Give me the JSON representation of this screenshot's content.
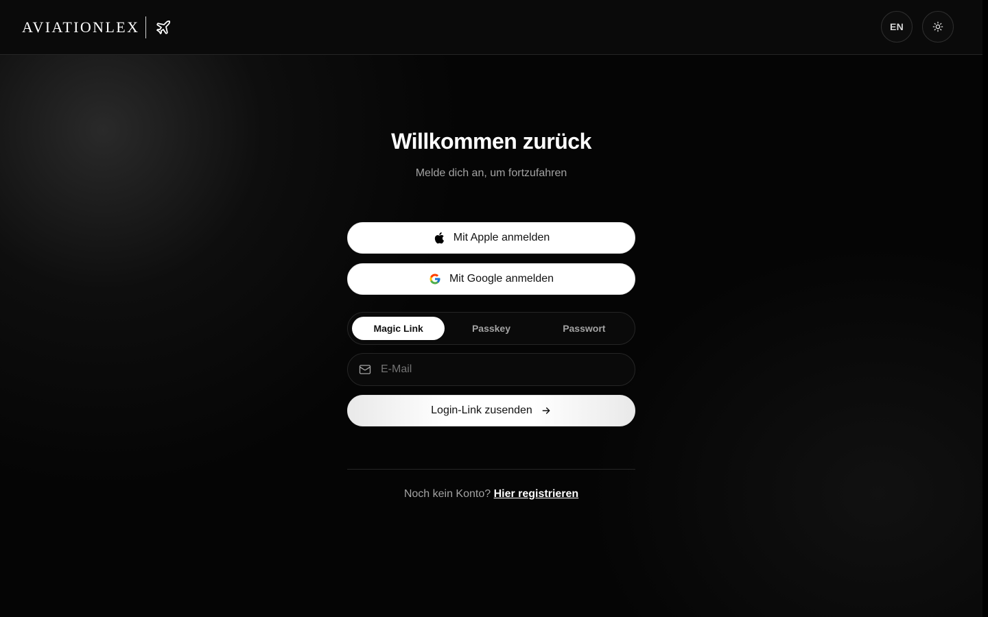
{
  "header": {
    "brand": "AVIATIONLEX",
    "language_label": "EN",
    "icons": {
      "logo": "airplane-icon",
      "theme": "sun-icon"
    }
  },
  "main": {
    "title": "Willkommen zurück",
    "subtitle": "Melde dich an, um fortzufahren",
    "apple_button": "Mit Apple anmelden",
    "google_button": "Mit Google anmelden",
    "tabs": [
      {
        "label": "Magic Link",
        "active": true
      },
      {
        "label": "Passkey",
        "active": false
      },
      {
        "label": "Passwort",
        "active": false
      }
    ],
    "email": {
      "placeholder": "E-Mail",
      "value": "",
      "icon": "mail-icon"
    },
    "submit_button": "Login-Link zusenden",
    "register_prompt": "Noch kein Konto?",
    "register_link": "Hier registrieren"
  },
  "colors": {
    "background": "#050505",
    "header_background": "#0a0a0a",
    "border": "#262626",
    "button_background": "#ffffff",
    "muted_text": "#a3a3a3",
    "google_blue": "#4285F4",
    "google_red": "#EA4335",
    "google_yellow": "#FBBC05",
    "google_green": "#34A853"
  }
}
